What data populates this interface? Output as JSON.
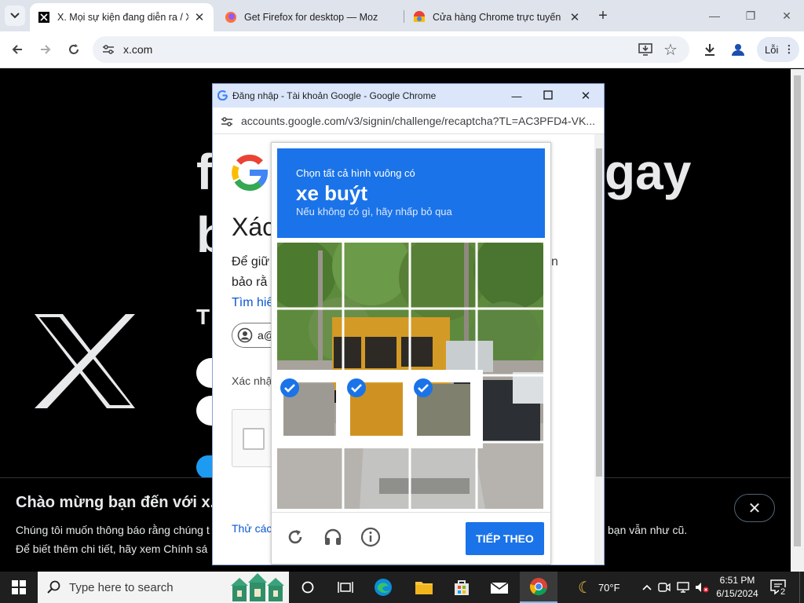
{
  "browser": {
    "tabs": [
      {
        "title": "X. Mọi sự kiện đang diễn ra / X",
        "active": true
      },
      {
        "title": "Get Firefox for desktop — Moz",
        "active": false
      },
      {
        "title": "Cửa hàng Chrome trực tuyến",
        "active": false
      }
    ],
    "new_tab": "+",
    "address": "x.com",
    "error_label": "Lỗi"
  },
  "x_page": {
    "headline_1_right": "gay",
    "headline_2_left": "b",
    "sub_left": "T",
    "cookie_title": "Chào mừng bạn đến với x.c",
    "cookie_line1": "Chúng tôi muốn thông báo rằng chúng t",
    "cookie_line2": "Để biết thêm chi tiết, hãy xem Chính sá",
    "cookie_right": "bạn vẫn như cũ.",
    "cookie_close": "✕"
  },
  "popup": {
    "window_title": "Đăng nhập - Tài khoản Google - Google Chrome",
    "url": "accounts.google.com/v3/signin/challenge/recaptcha?TL=AC3PFD4-VK...",
    "heading": "Xác",
    "para_line1": "Để giữ",
    "para_line2": "bảo rằ",
    "link_text": "Tìm hiể",
    "account_chip": "a@",
    "confirm_label": "Xác nhậ",
    "try_other": "Thử các",
    "right_letter": "n"
  },
  "recaptcha": {
    "instruction": "Chọn tất cả hình vuông có",
    "target": "xe buýt",
    "hint": "Nếu không có gì, hãy nhấp bỏ qua",
    "verify_button": "TIẾP THEO",
    "selected_tiles": [
      6,
      7,
      8
    ],
    "icons": [
      "reload-icon",
      "audio-icon",
      "info-icon"
    ]
  },
  "taskbar": {
    "search_placeholder": "Type here to search",
    "weather": "70°F",
    "time": "6:51 PM",
    "date": "6/15/2024",
    "notification_count": "2"
  }
}
